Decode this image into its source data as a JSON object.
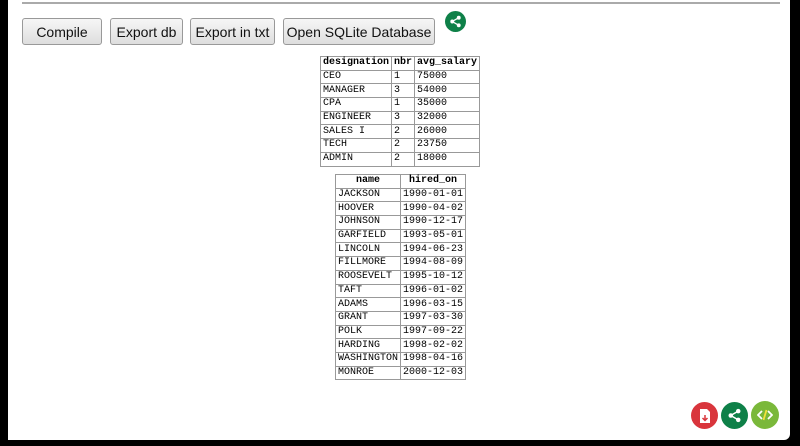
{
  "toolbar": {
    "compile": "Compile",
    "export_db": "Export db",
    "export_txt": "Export in txt",
    "open_sqlite": "Open SQLite Database"
  },
  "colors": {
    "share": "#0e8048",
    "pdf": "#d9353c",
    "code": "#7ab83a"
  },
  "table1": {
    "headers": [
      "designation",
      "nbr",
      "avg_salary"
    ],
    "rows": [
      [
        "CEO",
        "1",
        "75000"
      ],
      [
        "MANAGER",
        "3",
        "54000"
      ],
      [
        "CPA",
        "1",
        "35000"
      ],
      [
        "ENGINEER",
        "3",
        "32000"
      ],
      [
        "SALES I",
        "2",
        "26000"
      ],
      [
        "TECH",
        "2",
        "23750"
      ],
      [
        "ADMIN",
        "2",
        "18000"
      ]
    ]
  },
  "table2": {
    "headers": [
      "name",
      "hired_on"
    ],
    "rows": [
      [
        "JACKSON",
        "1990-01-01"
      ],
      [
        "HOOVER",
        "1990-04-02"
      ],
      [
        "JOHNSON",
        "1990-12-17"
      ],
      [
        "GARFIELD",
        "1993-05-01"
      ],
      [
        "LINCOLN",
        "1994-06-23"
      ],
      [
        "FILLMORE",
        "1994-08-09"
      ],
      [
        "ROOSEVELT",
        "1995-10-12"
      ],
      [
        "TAFT",
        "1996-01-02"
      ],
      [
        "ADAMS",
        "1996-03-15"
      ],
      [
        "GRANT",
        "1997-03-30"
      ],
      [
        "POLK",
        "1997-09-22"
      ],
      [
        "HARDING",
        "1998-02-02"
      ],
      [
        "WASHINGTON",
        "1998-04-16"
      ],
      [
        "MONROE",
        "2000-12-03"
      ]
    ]
  }
}
